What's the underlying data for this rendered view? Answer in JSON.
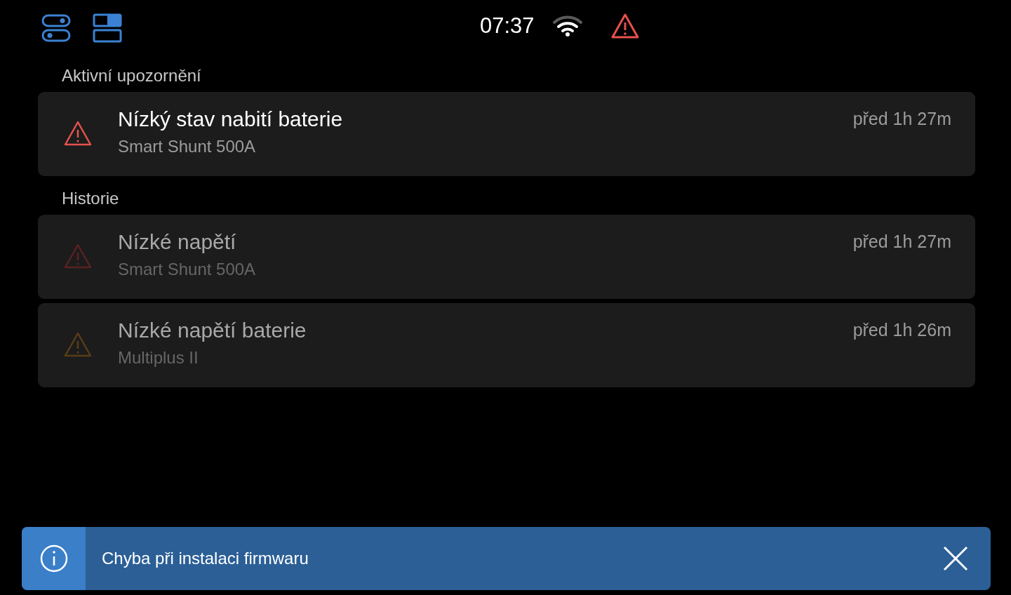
{
  "status_bar": {
    "time": "07:37",
    "alert": true
  },
  "sections": [
    {
      "heading": "Aktivní upozornění",
      "notifications": [
        {
          "title": "Nízký stav nabití baterie",
          "source": "Smart Shunt 500A",
          "time": "před 1h 27m",
          "kind": "alarm",
          "active": true
        }
      ]
    },
    {
      "heading": "Historie",
      "notifications": [
        {
          "title": "Nízké napětí",
          "source": "Smart Shunt 500A",
          "time": "před 1h 27m",
          "kind": "alarm",
          "active": false
        },
        {
          "title": "Nízké napětí baterie",
          "source": "Multiplus II",
          "time": "před 1h 26m",
          "kind": "warning",
          "active": false
        }
      ]
    }
  ],
  "toast": {
    "message": "Chyba při instalaci firmwaru"
  }
}
